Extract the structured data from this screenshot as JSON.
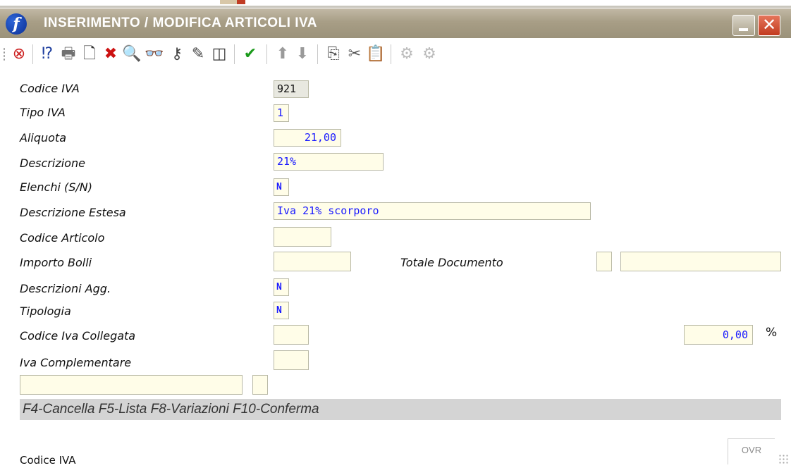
{
  "window": {
    "title": "INSERIMENTO / MODIFICA ARTICOLI IVA",
    "logo_letter": "f",
    "close_glyph": "✕"
  },
  "toolbar": {
    "icons": [
      {
        "name": "exit-icon",
        "glyph": "⊗",
        "color": "#cc2020",
        "enabled": true
      },
      {
        "name": "help-icon",
        "glyph": "⁉",
        "color": "#1f3f9f",
        "enabled": true
      },
      {
        "name": "print-icon",
        "glyph": "🖶",
        "color": "#707070",
        "enabled": true
      },
      {
        "name": "new-document-icon",
        "glyph": "🗋",
        "color": "#333333",
        "enabled": true
      },
      {
        "name": "delete-icon",
        "glyph": "✖",
        "color": "#cc1111",
        "enabled": true
      },
      {
        "name": "search-icon",
        "glyph": "🔍",
        "color": "#333333",
        "enabled": true
      },
      {
        "name": "find-binoculars-icon",
        "glyph": "👓",
        "color": "#333333",
        "enabled": true
      },
      {
        "name": "key-icon",
        "glyph": "⚷",
        "color": "#444444",
        "enabled": true
      },
      {
        "name": "magic-wand-icon",
        "glyph": "✎",
        "color": "#444444",
        "enabled": true
      },
      {
        "name": "columns-icon",
        "glyph": "◫",
        "color": "#333333",
        "enabled": true
      },
      {
        "name": "confirm-check-icon",
        "glyph": "✔",
        "color": "#1a9a1a",
        "enabled": true
      },
      {
        "name": "arrow-up-icon",
        "glyph": "⬆",
        "color": "#9a9a9a",
        "enabled": false
      },
      {
        "name": "arrow-down-icon",
        "glyph": "⬇",
        "color": "#9a9a9a",
        "enabled": false
      },
      {
        "name": "copy-icon",
        "glyph": "⎘",
        "color": "#555555",
        "enabled": true
      },
      {
        "name": "cut-icon",
        "glyph": "✂",
        "color": "#555555",
        "enabled": true
      },
      {
        "name": "paste-icon",
        "glyph": "📋",
        "color": "#888888",
        "enabled": true
      },
      {
        "name": "gears-icon",
        "glyph": "⚙",
        "color": "#bbbbbb",
        "enabled": false
      },
      {
        "name": "gears-alt-icon",
        "glyph": "⚙",
        "color": "#bbbbbb",
        "enabled": false
      }
    ]
  },
  "form": {
    "codice_iva": {
      "label": "Codice IVA",
      "value": "921"
    },
    "tipo_iva": {
      "label": "Tipo IVA",
      "value": "1"
    },
    "aliquota": {
      "label": "Aliquota",
      "value": "21,00"
    },
    "descrizione": {
      "label": "Descrizione",
      "value": "21%"
    },
    "elenchi": {
      "label": "Elenchi (S/N)",
      "value": "N"
    },
    "descrizione_estesa": {
      "label": "Descrizione Estesa",
      "value": "Iva 21% scorporo"
    },
    "codice_articolo": {
      "label": "Codice Articolo",
      "value": ""
    },
    "importo_bolli": {
      "label": "Importo Bolli",
      "value": ""
    },
    "totale_documento": {
      "label": "Totale Documento",
      "flag": "",
      "value": ""
    },
    "descrizioni_agg": {
      "label": "Descrizioni Agg.",
      "value": "N"
    },
    "tipologia": {
      "label": "Tipologia",
      "value": "N"
    },
    "codice_iva_collegata": {
      "label": "Codice Iva Collegata",
      "value": "",
      "percent_value": "0,00",
      "percent_symbol": "%"
    },
    "iva_complementare": {
      "label": "Iva Complementare",
      "value": ""
    },
    "extra_field_1": "",
    "extra_field_2": ""
  },
  "hints": "F4-Cancella F5-Lista F8-Variazioni F10-Conferma",
  "statusbar": {
    "field_name": "Codice IVA",
    "mode": "OVR"
  }
}
